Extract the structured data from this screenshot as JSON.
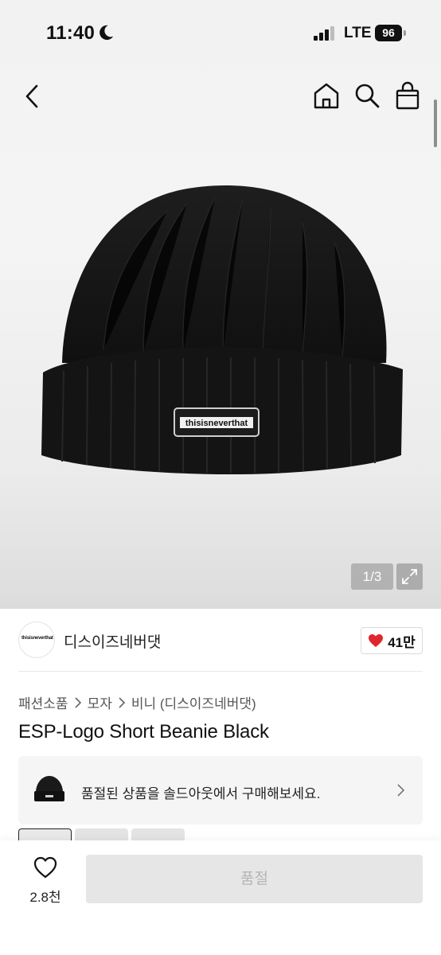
{
  "status_bar": {
    "time": "11:40",
    "network": "LTE",
    "battery": "96"
  },
  "image": {
    "counter": "1/3",
    "current": 1,
    "total": 3
  },
  "shop": {
    "logo_text": "thisisneverthat",
    "name": "디스이즈네버댓",
    "likes": "41만"
  },
  "breadcrumb": [
    "패션소품",
    "모자",
    "비니 (디스이즈네버댓)"
  ],
  "product": {
    "title": "ESP-Logo Short Beanie Black",
    "patch_text": "thisisneverthat"
  },
  "soldout_banner": {
    "text": "품절된 상품을 솔드아웃에서 구매해보세요."
  },
  "bottom": {
    "wish_count": "2.8천",
    "buy_label": "품절"
  },
  "colors": {
    "like_heart": "#e0262d",
    "accent_dark": "#111111",
    "disabled_bg": "#e6e6e6"
  }
}
